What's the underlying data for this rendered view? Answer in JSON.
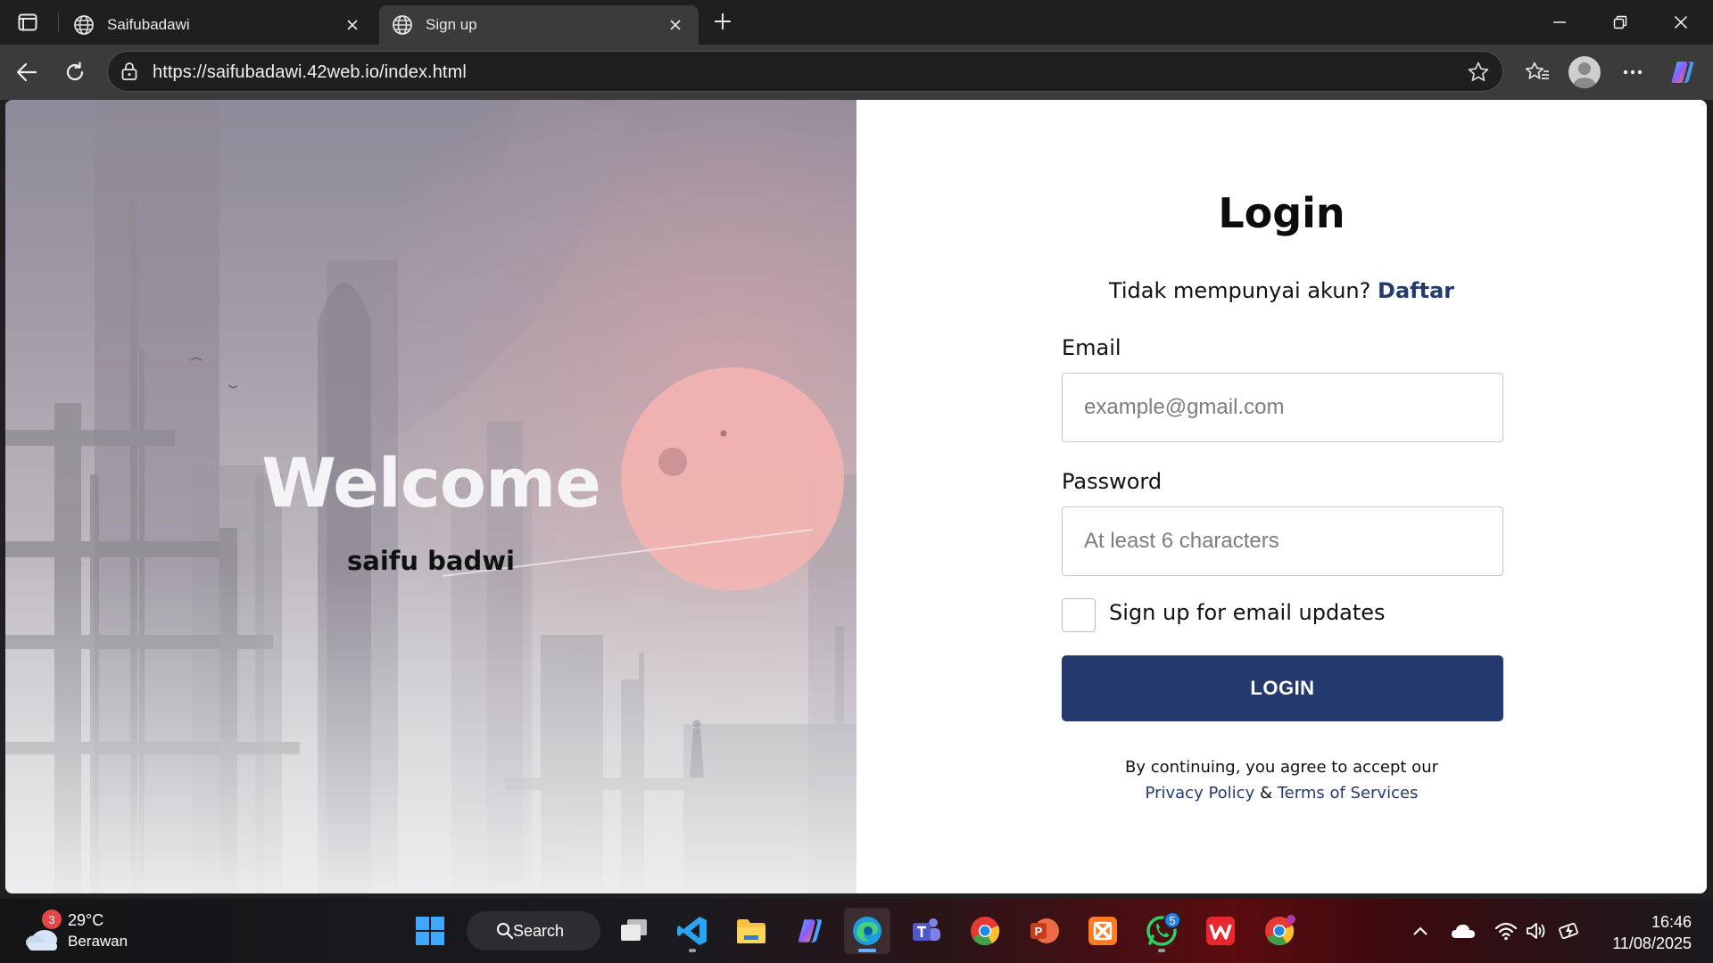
{
  "browser": {
    "tabs": [
      {
        "title": "Saifubadawi",
        "active": false
      },
      {
        "title": "Sign up",
        "active": true
      }
    ],
    "url": "https://saifubadawi.42web.io/index.html"
  },
  "page": {
    "hero": {
      "title": "Welcome",
      "subtitle": "saifu badwi"
    },
    "form": {
      "title": "Login",
      "signup_prompt": "Tidak mempunyai akun?",
      "signup_link": "Daftar",
      "email_label": "Email",
      "email_placeholder": "example@gmail.com",
      "email_value": "",
      "password_label": "Password",
      "password_placeholder": "At least 6 characters",
      "password_value": "",
      "checkbox_label": "Sign up for email updates",
      "checkbox_checked": false,
      "button_label": "LOGIN",
      "terms_line1": "By continuing, you agree to accept our",
      "privacy_link": "Privacy Policy",
      "ampersand": "&",
      "terms_link": "Terms of Services"
    },
    "colors": {
      "accent": "#243a6e",
      "hero_sun": "#f2b3b0"
    }
  },
  "taskbar": {
    "weather": {
      "temp": "29°C",
      "condition": "Berawan",
      "badge": "3"
    },
    "search_label": "Search",
    "apps": [
      {
        "name": "start",
        "icon": "windows-logo-icon"
      },
      {
        "name": "task-view",
        "icon": "task-view-icon"
      },
      {
        "name": "vscode",
        "icon": "vscode-icon"
      },
      {
        "name": "file-explorer",
        "icon": "folder-icon"
      },
      {
        "name": "copilot",
        "icon": "copilot-icon"
      },
      {
        "name": "edge",
        "icon": "edge-icon",
        "active": true
      },
      {
        "name": "teams",
        "icon": "teams-icon"
      },
      {
        "name": "chrome",
        "icon": "chrome-icon"
      },
      {
        "name": "powerpoint",
        "icon": "powerpoint-icon"
      },
      {
        "name": "xampp",
        "icon": "xampp-icon"
      },
      {
        "name": "whatsapp",
        "icon": "whatsapp-icon",
        "badge": "5"
      },
      {
        "name": "wps-office",
        "icon": "wps-icon"
      },
      {
        "name": "chrome-profile",
        "icon": "chrome-icon"
      }
    ],
    "clock": {
      "time": "16:46",
      "date": "11/08/2025"
    }
  }
}
